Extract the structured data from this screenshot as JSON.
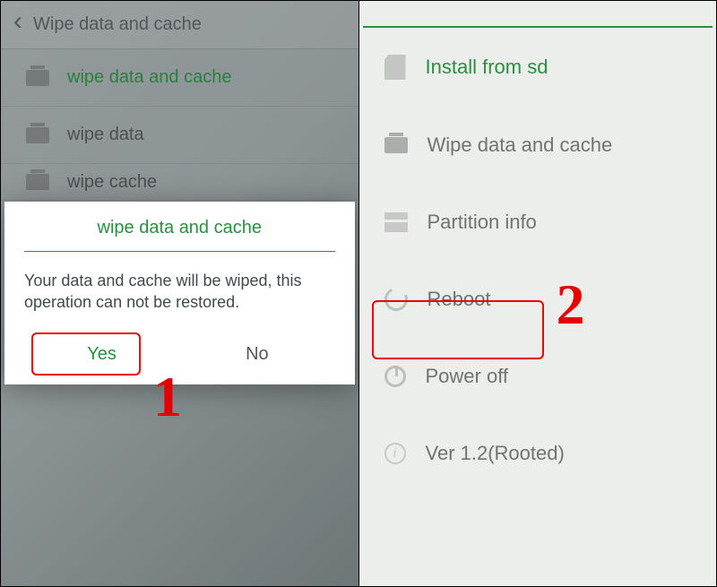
{
  "left": {
    "header_title": "Wipe data and cache",
    "items": [
      {
        "label": "wipe data and cache",
        "active": true
      },
      {
        "label": "wipe data",
        "active": false
      },
      {
        "label": "wipe cache",
        "active": false
      }
    ],
    "dialog": {
      "title": "wipe data and cache",
      "body": "Your data and cache will be wiped, this operation can not be restored.",
      "yes": "Yes",
      "no": "No"
    },
    "annotation_number": "1"
  },
  "right": {
    "items": [
      {
        "label": "Install from sd",
        "icon": "sd",
        "active": true
      },
      {
        "label": "Wipe data and cache",
        "icon": "wipe",
        "active": false
      },
      {
        "label": "Partition info",
        "icon": "part",
        "active": false
      },
      {
        "label": "Reboot",
        "icon": "reboot",
        "active": false
      },
      {
        "label": "Power off",
        "icon": "power",
        "active": false
      },
      {
        "label": "Ver 1.2(Rooted)",
        "icon": "info",
        "active": false
      }
    ],
    "annotation_number": "2"
  },
  "colors": {
    "accent": "#2a8f3f",
    "annotation": "#e60000"
  }
}
